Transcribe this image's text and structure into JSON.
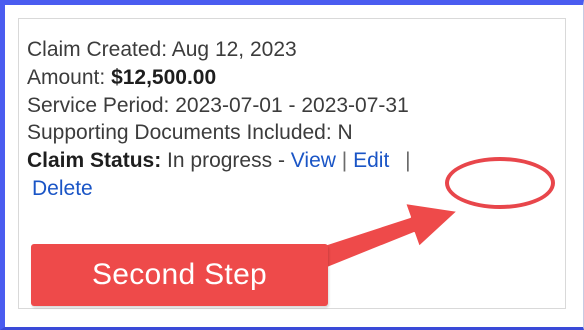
{
  "claim": {
    "created_label": "Claim Created:",
    "created_value": "Aug 12, 2023",
    "amount_label": "Amount:",
    "amount_value": "$12,500.00",
    "period_label": "Service Period:",
    "period_value": "2023-07-01 - 2023-07-31",
    "docs_label": "Supporting Documents Included:",
    "docs_value": "N",
    "status_label": "Claim Status:",
    "status_value": "In progress",
    "dash": "-",
    "view_link": "View",
    "separator": "|",
    "edit_link": "Edit",
    "delete_link": "Delete"
  },
  "annotation": {
    "callout_text": "Second Step",
    "color": "#ee4a4a"
  },
  "colors": {
    "frame_border": "#4a5cf0",
    "link": "#1a55c6",
    "text": "#3c3c3c"
  }
}
